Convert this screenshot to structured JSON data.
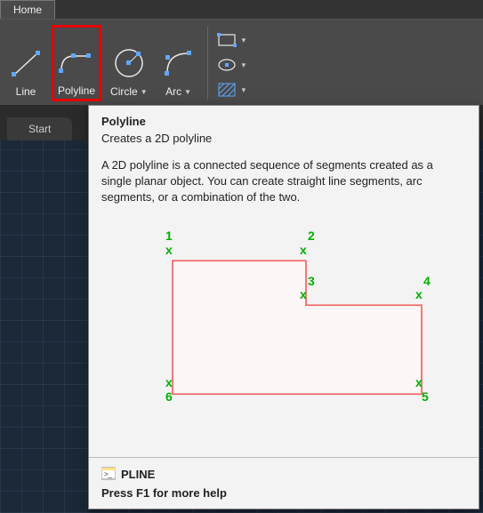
{
  "tabs": {
    "home": "Home"
  },
  "tools": {
    "line": "Line",
    "polyline": "Polyline",
    "circle": "Circle",
    "arc": "Arc"
  },
  "start_tab": "Start",
  "tooltip": {
    "title": "Polyline",
    "subtitle": "Creates a 2D polyline",
    "description": "A 2D polyline is a connected sequence of segments created as a single planar object. You can create straight line segments, arc segments, or a combination of the two.",
    "vertices": {
      "v1": "1",
      "v2": "2",
      "v3": "3",
      "v4": "4",
      "v5": "5",
      "v6": "6"
    },
    "command": "PLINE",
    "help": "Press F1 for more help"
  }
}
